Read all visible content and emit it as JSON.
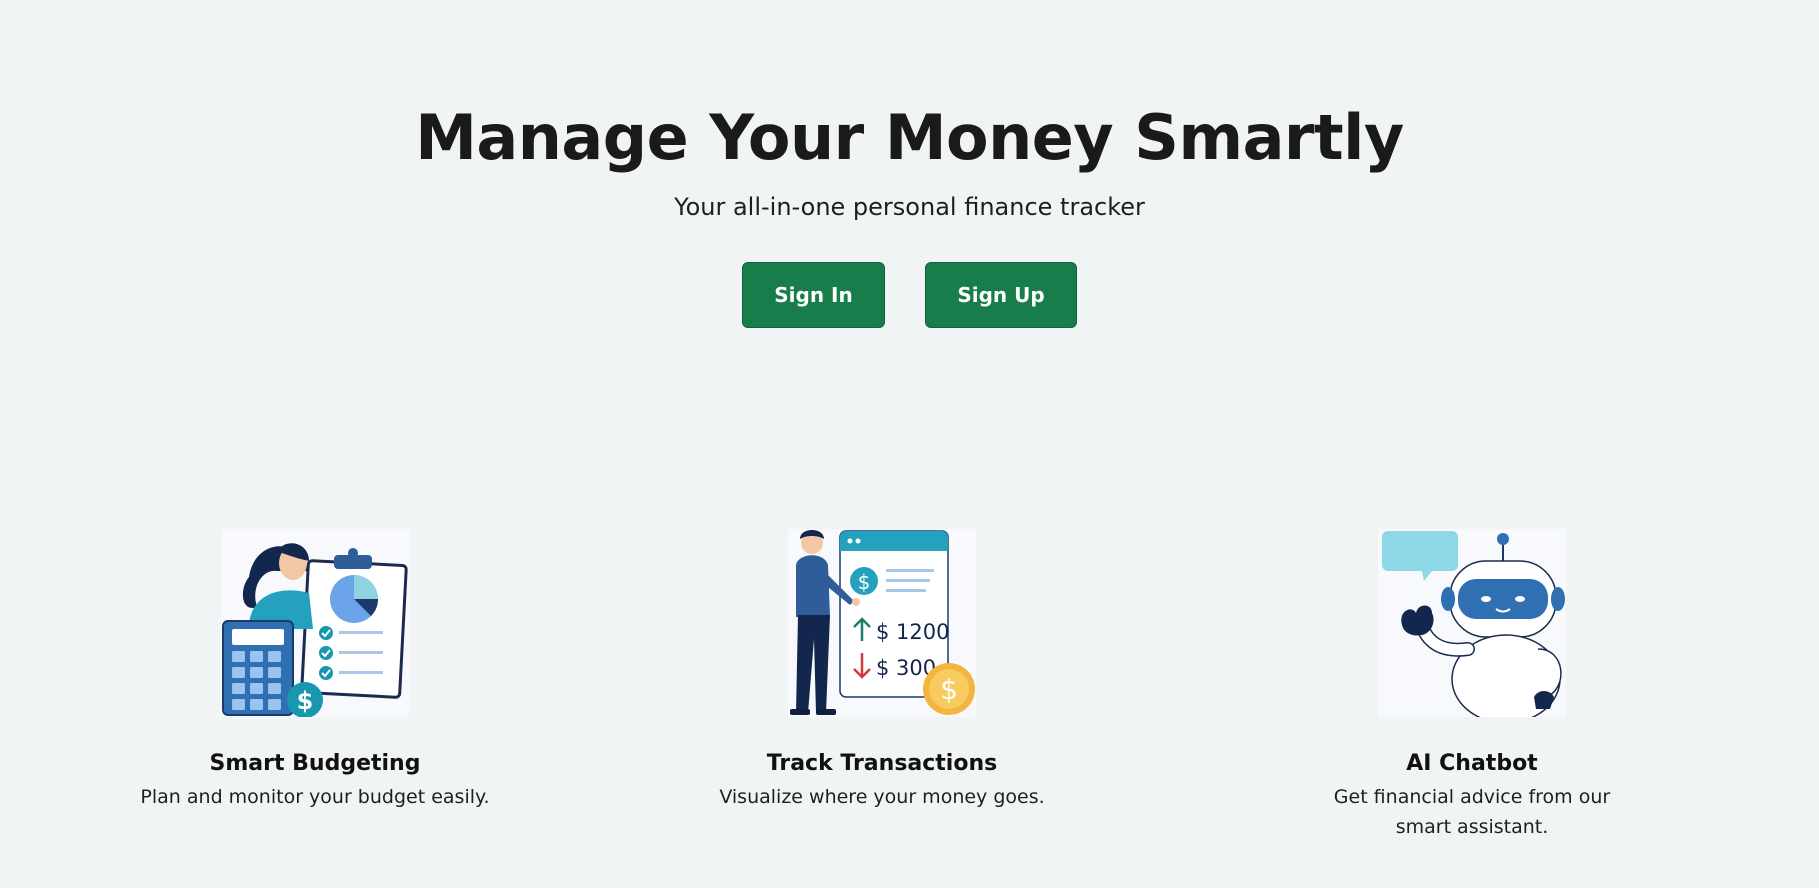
{
  "hero": {
    "title": "Manage Your Money Smartly",
    "subtitle": "Your all-in-one personal finance tracker"
  },
  "actions": {
    "sign_in_label": "Sign In",
    "sign_up_label": "Sign Up"
  },
  "features": [
    {
      "title": "Smart Budgeting",
      "description": "Plan and monitor your budget easily.",
      "illustration": "budget-illustration"
    },
    {
      "title": "Track Transactions",
      "description": "Visualize where your money goes.",
      "illustration": "transactions-illustration",
      "amount_in": "$ 1200",
      "amount_out": "$ 300"
    },
    {
      "title": "AI Chatbot",
      "description": "Get financial advice from our smart assistant.",
      "illustration": "robot-illustration"
    }
  ],
  "colors": {
    "background": "#f1f4f5",
    "button": "#177d4a",
    "teal": "#24a1bd",
    "navy": "#1b3a6b"
  }
}
